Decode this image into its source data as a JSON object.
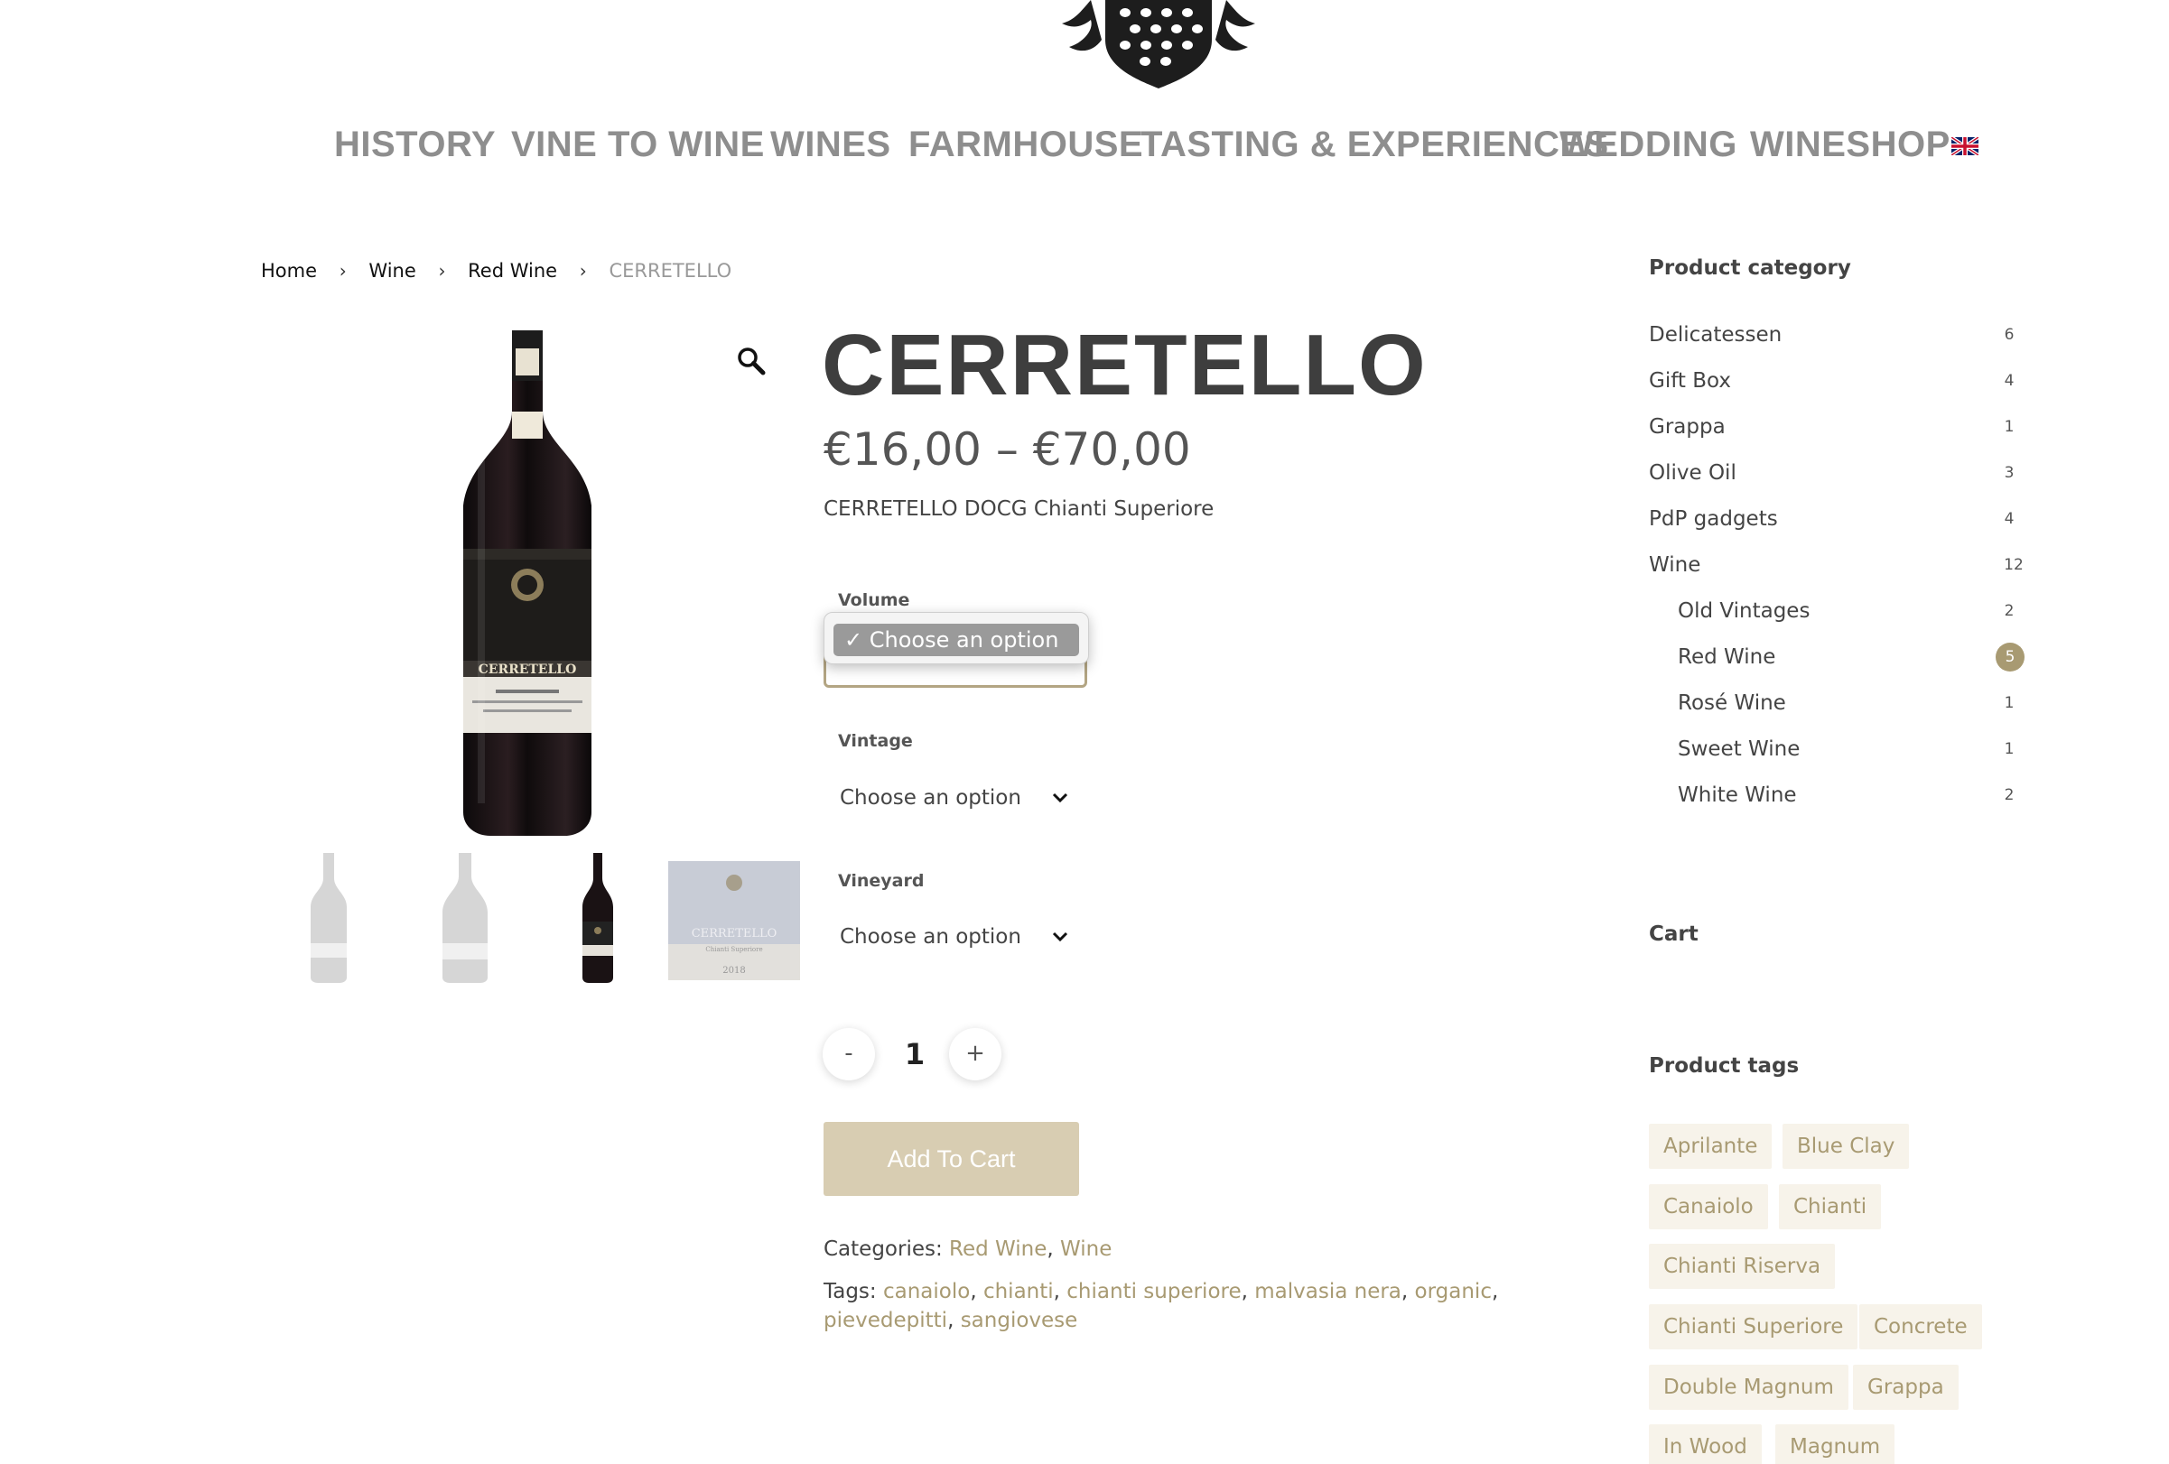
{
  "header": {
    "logo_icon": "family-crest-logo",
    "nav": [
      {
        "label": "HISTORY"
      },
      {
        "label": "VINE TO WINE"
      },
      {
        "label": "WINES"
      },
      {
        "label": "FARMHOUSE"
      },
      {
        "label": "TASTING & EXPERIENCES"
      },
      {
        "label": "WEDDING"
      },
      {
        "label": "WINESHOP"
      }
    ],
    "language_icon": "uk-flag-icon"
  },
  "breadcrumb": {
    "items": [
      "Home",
      "Wine",
      "Red Wine"
    ],
    "current": "CERRETELLO",
    "separator": "›"
  },
  "gallery": {
    "zoom_icon": "magnifier-icon",
    "thumbnails": [
      "bottle-thumbnail",
      "magnum-thumbnail",
      "bottle-thumbnail",
      "label-thumbnail"
    ],
    "label_text": "CERRETELLO",
    "label_subtitle": "Chianti Superiore",
    "label_year": "2018"
  },
  "product": {
    "title": "CERRETELLO",
    "price": "€16,00 – €70,00",
    "short_description": "CERRETELLO DOCG Chianti Superiore",
    "options": {
      "volume": {
        "label": "Volume",
        "selected": "Choose an option",
        "open": true
      },
      "vintage": {
        "label": "Vintage",
        "selected": "Choose an option"
      },
      "vineyard": {
        "label": "Vineyard",
        "selected": "Choose an option"
      }
    },
    "dropdown": {
      "checkmark": "✓",
      "option": "Choose an option"
    },
    "quantity": {
      "minus": "-",
      "value": "1",
      "plus": "+"
    },
    "add_to_cart": "Add To Cart",
    "categories": {
      "label": "Categories:",
      "items": [
        "Red Wine",
        "Wine"
      ]
    },
    "tags": {
      "label": "Tags:",
      "items": [
        "canaiolo",
        "chianti",
        "chianti superiore",
        "malvasia nera",
        "organic",
        "pievedepitti",
        "sangiovese"
      ]
    }
  },
  "sidebar": {
    "product_category": {
      "heading": "Product category",
      "items": [
        {
          "label": "Delicatessen",
          "count": "6"
        },
        {
          "label": "Gift Box",
          "count": "4"
        },
        {
          "label": "Grappa",
          "count": "1"
        },
        {
          "label": "Olive Oil",
          "count": "3"
        },
        {
          "label": "PdP gadgets",
          "count": "4"
        },
        {
          "label": "Wine",
          "count": "12"
        },
        {
          "label": "Old Vintages",
          "count": "2"
        },
        {
          "label": "Red Wine",
          "count": "5",
          "active": true
        },
        {
          "label": "Rosé Wine",
          "count": "1"
        },
        {
          "label": "Sweet Wine",
          "count": "1"
        },
        {
          "label": "White Wine",
          "count": "2"
        }
      ]
    },
    "cart": {
      "heading": "Cart"
    },
    "product_tags": {
      "heading": "Product tags",
      "items": [
        "Aprilante",
        "Blue Clay",
        "Canaiolo",
        "Chianti",
        "Chianti Riserva",
        "Chianti Superiore",
        "Concrete",
        "Double Magnum",
        "Grappa",
        "In Wood",
        "Magnum"
      ]
    }
  },
  "colors": {
    "accent": "#a89a72",
    "button": "#d8cdb2",
    "nav": "#8e8e8e",
    "text": "#444444"
  }
}
